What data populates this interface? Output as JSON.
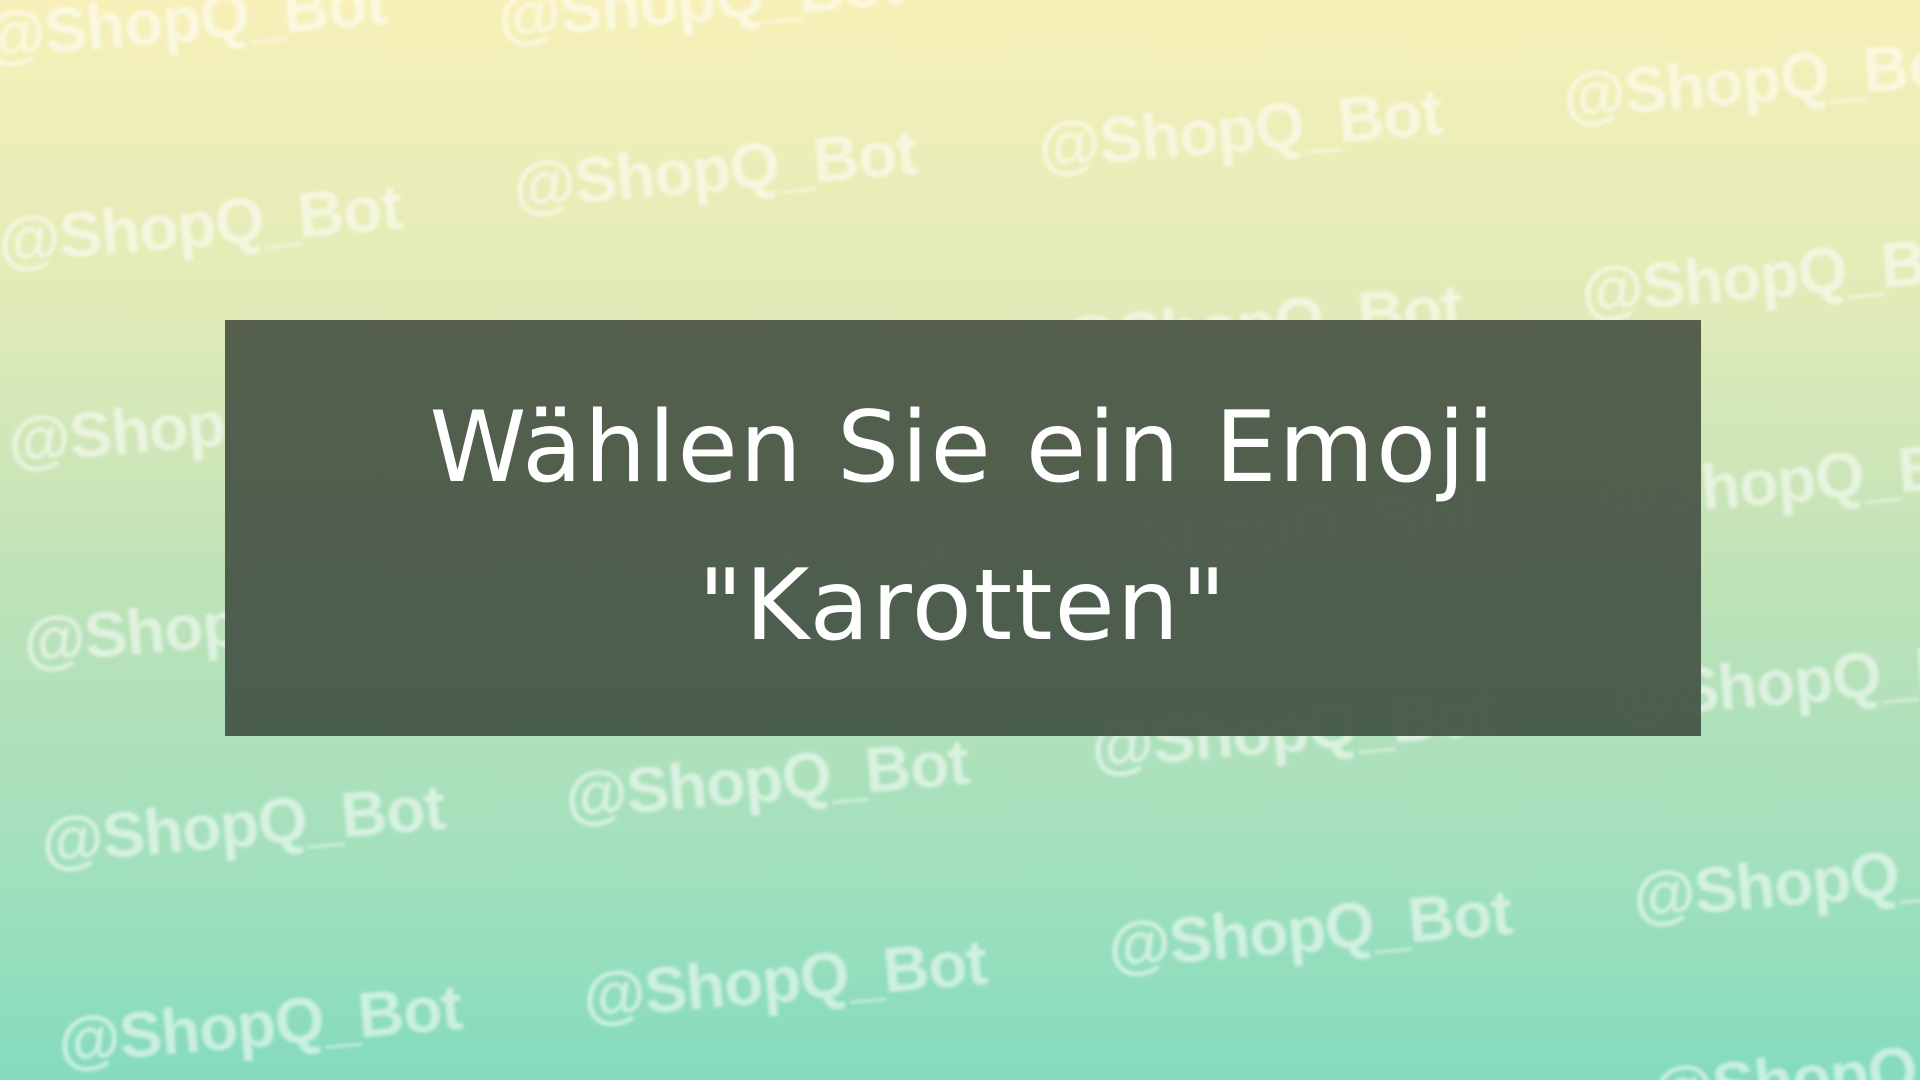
{
  "background": {
    "gradient_top": "#f7f0b8",
    "gradient_bottom": "#84dbbd",
    "watermark_text": "@ShopQ_Bot",
    "watermark_color": "rgba(255,255,255,0.55)"
  },
  "card": {
    "background_color": "#4f5a48",
    "text_color": "#ffffff",
    "line1": "Wählen Sie ein Emoji",
    "line2": "\"Karotten\""
  }
}
